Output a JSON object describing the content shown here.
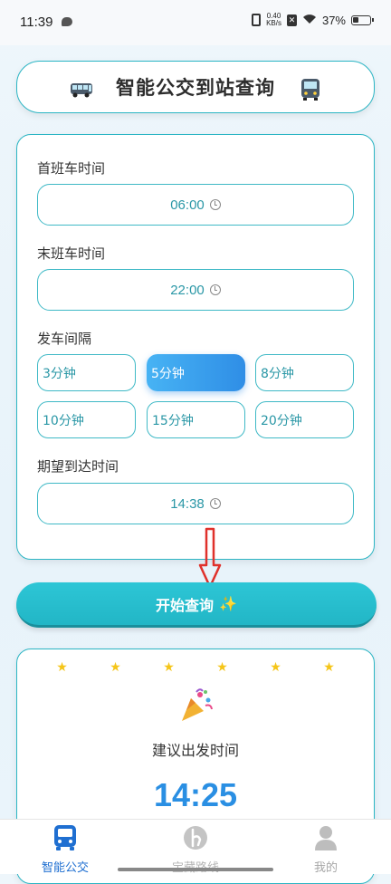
{
  "status_bar": {
    "time": "11:39",
    "network_speed_value": "0.40",
    "network_speed_unit": "KB/s",
    "battery": "37%"
  },
  "header": {
    "title": "智能公交到站查询"
  },
  "form": {
    "first_bus_label": "首班车时间",
    "first_bus_value": "06:00",
    "last_bus_label": "末班车时间",
    "last_bus_value": "22:00",
    "interval_label": "发车间隔",
    "interval_options": [
      "3分钟",
      "5分钟",
      "8分钟",
      "10分钟",
      "15分钟",
      "20分钟"
    ],
    "interval_selected": "5分钟",
    "arrival_label": "期望到达时间",
    "arrival_value": "14:38"
  },
  "query_button": {
    "label": "开始查询",
    "emoji": "✨"
  },
  "result": {
    "label": "建议出发时间",
    "time": "14:25"
  },
  "tabbar": {
    "tabs": [
      {
        "label": "智能公交",
        "icon": "bus-icon",
        "active": true
      },
      {
        "label": "宝藏路线",
        "icon": "route-icon",
        "active": false
      },
      {
        "label": "我的",
        "icon": "person-icon",
        "active": false
      }
    ]
  },
  "colors": {
    "accent": "#2bb5c4",
    "selected": "#2f8ee6",
    "result_time": "#2a8fe3",
    "active_tab": "#1f6fd1",
    "arrow": "#e0312b"
  }
}
